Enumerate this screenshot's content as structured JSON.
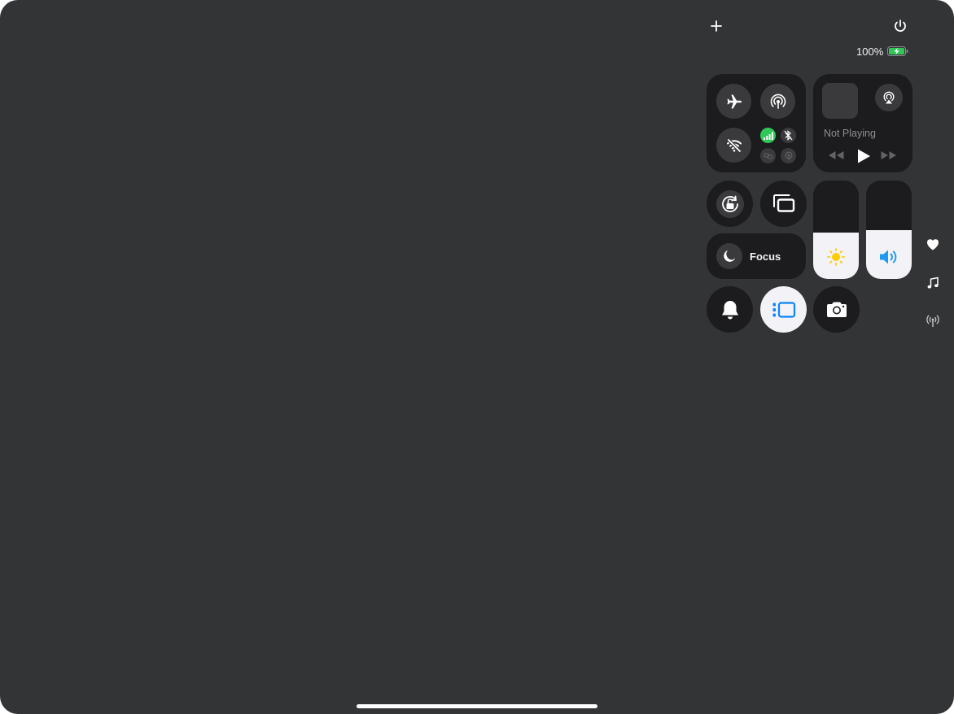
{
  "status": {
    "battery_percent": "100%",
    "charging": true
  },
  "top": {
    "add_icon": "plus-icon",
    "power_icon": "power-icon"
  },
  "connectivity": {
    "airplane": {
      "icon": "airplane-icon",
      "on": false
    },
    "airdrop": {
      "icon": "airdrop-icon",
      "on": false
    },
    "wifi": {
      "icon": "wifi-off-icon",
      "on": false
    },
    "cellular": {
      "icon": "cellular-icon",
      "on": true,
      "color": "#30c759"
    },
    "bluetooth": {
      "icon": "bluetooth-off-icon",
      "on": false
    },
    "link": {
      "icon": "link-icon",
      "on": false
    },
    "hotspot": {
      "icon": "hotspot-icon",
      "on": false
    }
  },
  "media": {
    "status": "Not Playing",
    "airplay_icon": "airplay-audio-icon"
  },
  "controls": {
    "orientation_lock": "rotation-lock-icon",
    "screen_mirroring": "screen-mirroring-icon",
    "focus_label": "Focus",
    "focus_icon": "moon-icon",
    "silent": "bell-icon",
    "stage_manager": {
      "icon": "stage-manager-icon",
      "on": true,
      "color": "#0a84ff"
    },
    "camera": "camera-icon"
  },
  "sliders": {
    "brightness": {
      "level": 0.47,
      "icon": "sun-icon",
      "icon_color": "#ffcc00"
    },
    "volume": {
      "level": 0.5,
      "icon": "speaker-icon",
      "icon_color": "#1e9bf0"
    }
  },
  "side_rail": [
    "heart-icon",
    "music-note-icon",
    "antenna-icon"
  ],
  "colors": {
    "background": "#333436",
    "tile": "#1c1c1e",
    "button": "#3a3a3c"
  }
}
